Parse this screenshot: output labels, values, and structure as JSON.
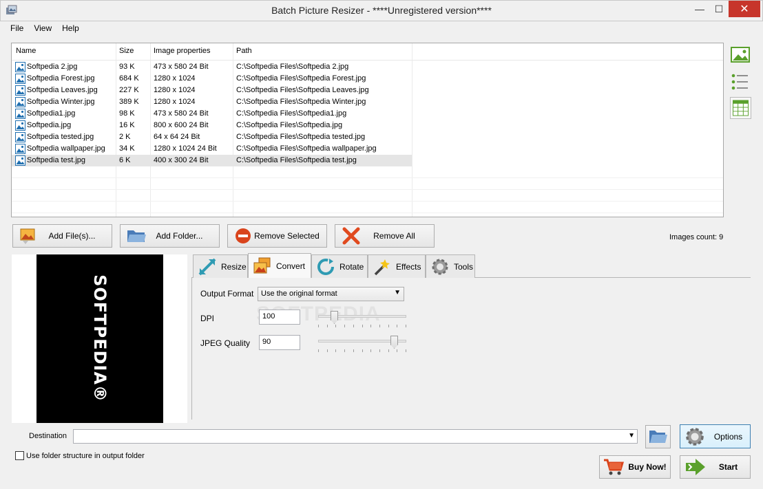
{
  "window": {
    "title": "Batch Picture Resizer - ****Unregistered version****",
    "minimize": "—",
    "maximize": "☐",
    "close": "✕"
  },
  "menu": [
    "File",
    "View",
    "Help"
  ],
  "file_list": {
    "columns": [
      "Name",
      "Size",
      "Image properties",
      "Path"
    ],
    "rows": [
      {
        "name": "Softpedia 2.jpg",
        "size": "93 K",
        "props": "473 x 580  24 Bit",
        "path": "C:\\Softpedia Files\\Softpedia 2.jpg"
      },
      {
        "name": "Softpedia Forest.jpg",
        "size": "684 K",
        "props": "1280 x 1024",
        "path": "C:\\Softpedia Files\\Softpedia Forest.jpg"
      },
      {
        "name": "Softpedia Leaves.jpg",
        "size": "227 K",
        "props": "1280 x 1024",
        "path": "C:\\Softpedia Files\\Softpedia Leaves.jpg"
      },
      {
        "name": "Softpedia Winter.jpg",
        "size": "389 K",
        "props": "1280 x 1024",
        "path": "C:\\Softpedia Files\\Softpedia Winter.jpg"
      },
      {
        "name": "Softpedia1.jpg",
        "size": "98 K",
        "props": "473 x 580  24 Bit",
        "path": "C:\\Softpedia Files\\Softpedia1.jpg"
      },
      {
        "name": "Softpedia.jpg",
        "size": "16 K",
        "props": "800 x 600  24 Bit",
        "path": "C:\\Softpedia Files\\Softpedia.jpg"
      },
      {
        "name": "Softpedia tested.jpg",
        "size": "2 K",
        "props": "64 x 64  24 Bit",
        "path": "C:\\Softpedia Files\\Softpedia tested.jpg"
      },
      {
        "name": "Softpedia wallpaper.jpg",
        "size": "34 K",
        "props": "1280 x 1024  24 Bit",
        "path": "C:\\Softpedia Files\\Softpedia wallpaper.jpg"
      },
      {
        "name": "Softpedia test.jpg",
        "size": "6 K",
        "props": "400 x 300  24 Bit",
        "path": "C:\\Softpedia Files\\Softpedia test.jpg"
      }
    ],
    "selected_index": 8
  },
  "actions": {
    "add_files": "Add File(s)...",
    "add_folder": "Add Folder...",
    "remove_selected": "Remove Selected",
    "remove_all": "Remove All",
    "images_count": "Images count: 9"
  },
  "preview": {
    "logo_text": "SOFTPEDIA®"
  },
  "tabs": {
    "resize": "Resize",
    "convert": "Convert",
    "rotate": "Rotate",
    "effects": "Effects",
    "tools": "Tools",
    "active": "convert"
  },
  "convert": {
    "output_format_label": "Output Format",
    "output_format_value": "Use the original format",
    "dpi_label": "DPI",
    "dpi_value": "100",
    "dpi_slider_fraction": 0.15,
    "jpeg_quality_label": "JPEG Quality",
    "jpeg_quality_value": "90",
    "jpeg_slider_fraction": 0.9,
    "watermark": "SOFTPEDIA"
  },
  "destination": {
    "label": "Destination",
    "value": "",
    "use_folder_structure": "Use folder structure in output folder",
    "use_folder_structure_checked": false
  },
  "buttons": {
    "options": "Options",
    "buy_now": "Buy Now!",
    "start": "Start"
  },
  "colors": {
    "accent_green": "#5aa02c",
    "close_red": "#c7352b",
    "options_border": "#3c7fb1"
  }
}
